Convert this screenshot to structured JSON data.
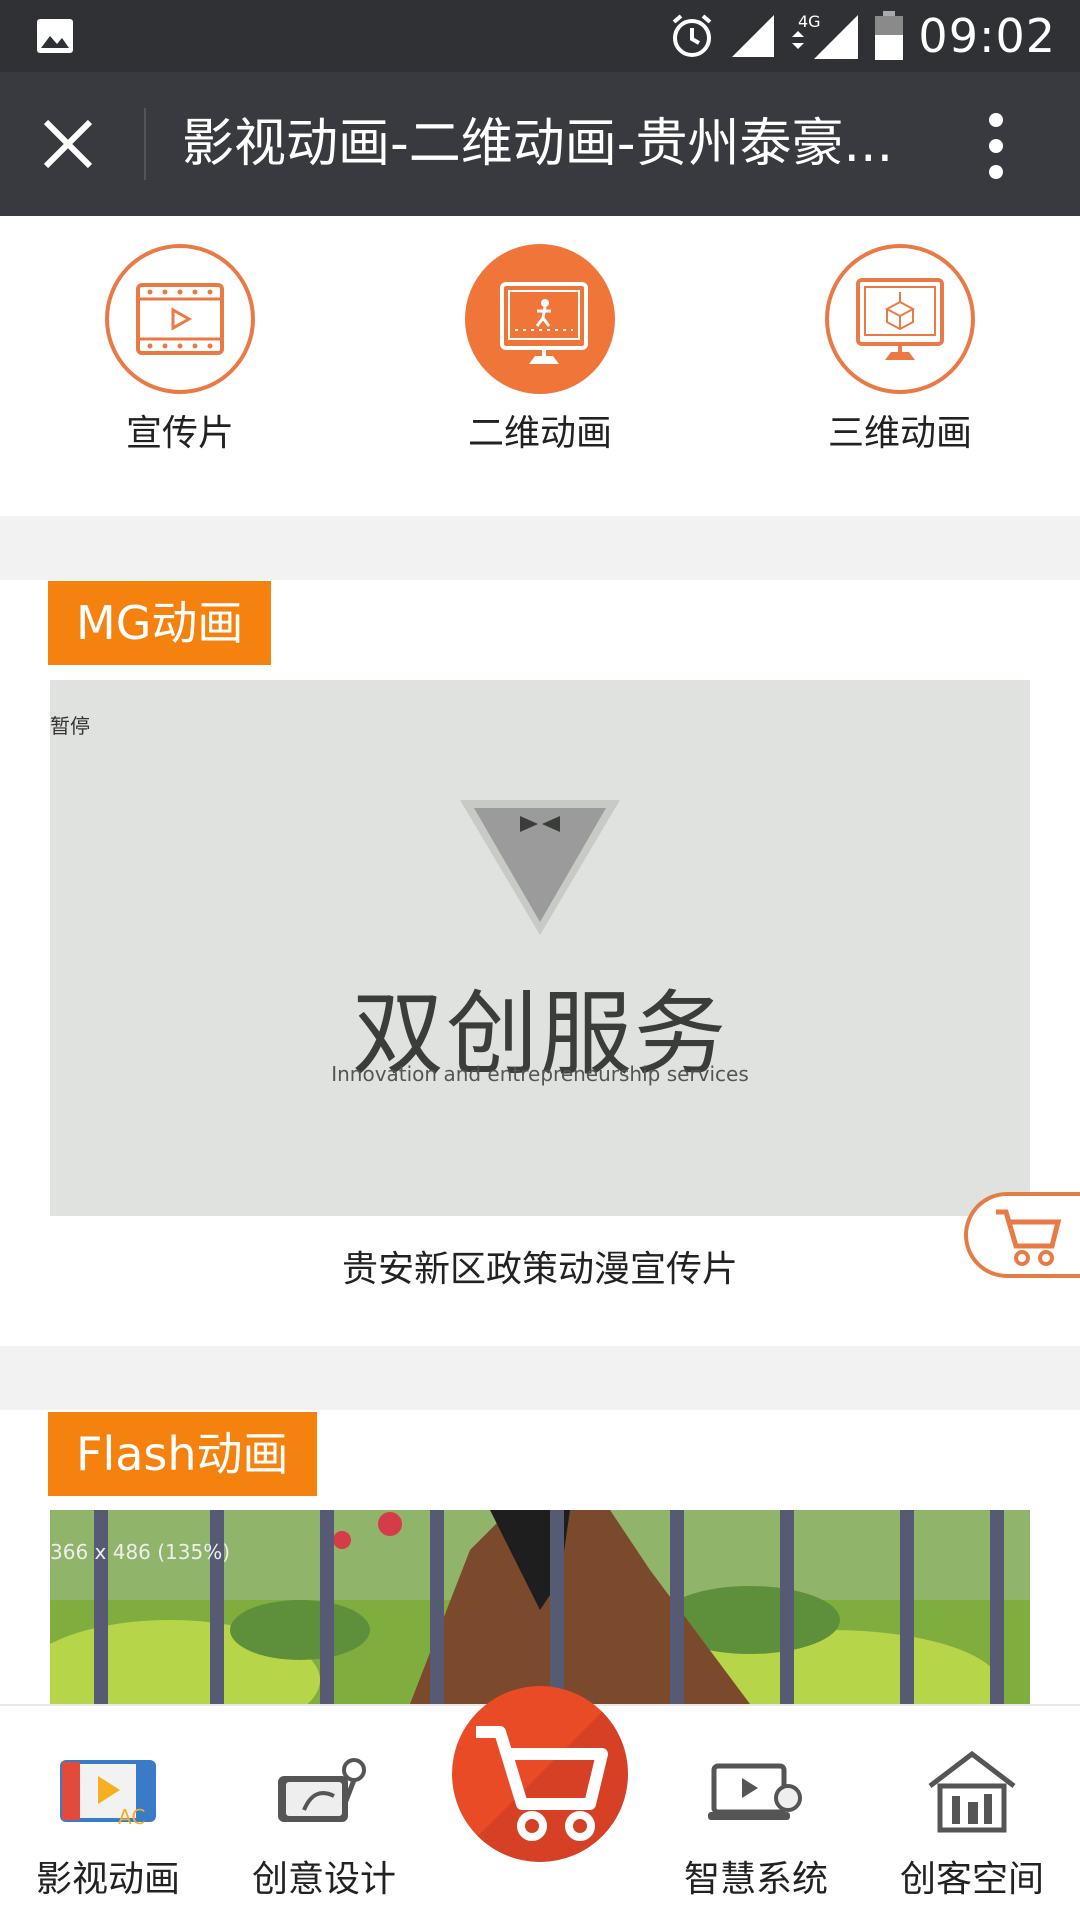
{
  "status_bar": {
    "time": "09:02",
    "network": "4G",
    "icons": [
      "image-icon",
      "alarm-icon",
      "signal-icon",
      "network-4g-icon",
      "battery-icon"
    ]
  },
  "title_bar": {
    "title": "影视动画-二维动画-贵州泰豪...",
    "icons": [
      "close-icon",
      "more-icon"
    ]
  },
  "categories": [
    {
      "label": "宣传片",
      "icon": "video-film-icon",
      "active": false
    },
    {
      "label": "二维动画",
      "icon": "monitor-2d-icon",
      "active": true
    },
    {
      "label": "三维动画",
      "icon": "monitor-3d-icon",
      "active": false
    }
  ],
  "sections": [
    {
      "tag": "MG动画",
      "video_overlay": "暂停",
      "video_title": "双创服务",
      "video_subtitle": "Innovation and entrepreneurship services",
      "caption": "贵安新区政策动漫宣传片"
    },
    {
      "tag": "Flash动画",
      "video_overlay": "366 x 486 (135%)"
    }
  ],
  "bottom_nav": [
    {
      "label": "影视动画",
      "icon": "film-animation-icon"
    },
    {
      "label": "创意设计",
      "icon": "tablet-design-icon"
    },
    {
      "label": "",
      "icon": "shopping-cart-icon"
    },
    {
      "label": "智慧系统",
      "icon": "smart-system-icon"
    },
    {
      "label": "创客空间",
      "icon": "maker-space-icon"
    }
  ],
  "colors": {
    "accent": "#f5820f",
    "icon_orange": "#ea7a45",
    "header": "#393a3f",
    "status": "#303134",
    "cart_red": "#e94b27"
  }
}
